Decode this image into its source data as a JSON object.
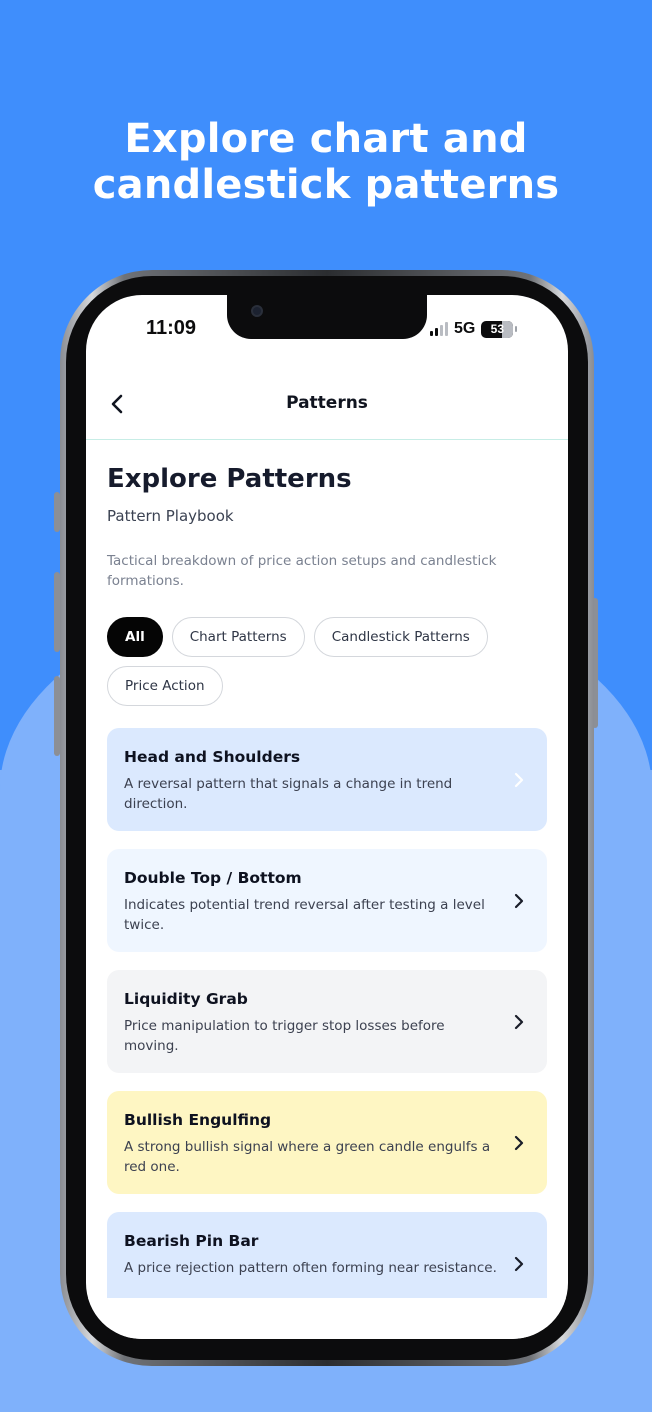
{
  "headline": "Explore chart and candlestick patterns",
  "status": {
    "time": "11:09",
    "network": "5G",
    "battery": "53"
  },
  "nav": {
    "title": "Patterns",
    "back_icon": "chevron-left-icon"
  },
  "header": {
    "title": "Explore Patterns",
    "subtitle": "Pattern Playbook",
    "description": "Tactical breakdown of price action setups and candlestick formations."
  },
  "filters": [
    {
      "label": "All",
      "selected": true
    },
    {
      "label": "Chart Patterns",
      "selected": false
    },
    {
      "label": "Candlestick Patterns",
      "selected": false
    },
    {
      "label": "Price Action",
      "selected": false
    }
  ],
  "patterns": [
    {
      "title": "Head and Shoulders",
      "description": "A reversal pattern that signals a change in trend direction.",
      "bg": "#dbe9fe",
      "chevron": "#ffffff"
    },
    {
      "title": "Double Top / Bottom",
      "description": "Indicates potential trend reversal after testing a level twice.",
      "bg": "#eff6ff",
      "chevron": "#1a1e2a"
    },
    {
      "title": "Liquidity Grab",
      "description": "Price manipulation to trigger stop losses before moving.",
      "bg": "#f3f4f6",
      "chevron": "#1a1e2a"
    },
    {
      "title": "Bullish Engulfing",
      "description": "A strong bullish signal where a green candle engulfs a red one.",
      "bg": "#fef6c3",
      "chevron": "#1a1e2a"
    },
    {
      "title": "Bearish Pin Bar",
      "description": "A price rejection pattern often forming near resistance.",
      "bg": "#dbe9fe",
      "chevron": "#1a1e2a"
    }
  ],
  "colors": {
    "background_top": "#3f8efc",
    "background_bottom": "#7fb1fb",
    "chip_active": "#050505",
    "divider": "#c7ede6"
  }
}
